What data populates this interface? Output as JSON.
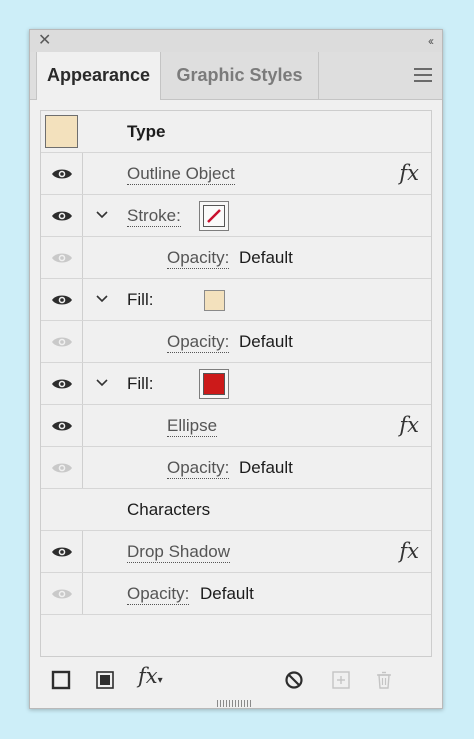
{
  "window": {
    "close_glyph": "✕",
    "collapse_glyph": "‹‹"
  },
  "tabs": [
    {
      "label": "Appearance",
      "active": true
    },
    {
      "label": "Graphic Styles",
      "active": false
    }
  ],
  "header": {
    "title": "Type",
    "swatch_color": "#f3e1bd"
  },
  "rows": [
    {
      "label": "Outline Object",
      "fx": "fx"
    },
    {
      "label": "Stroke:",
      "stroke_color": "#c8102e"
    },
    {
      "label": "Opacity:",
      "value": "Default"
    },
    {
      "label": "Fill:",
      "fill_color": "#f3e1bd"
    },
    {
      "label": "Opacity:",
      "value": "Default"
    },
    {
      "label": "Fill:",
      "fill_color": "#cc1a1a"
    },
    {
      "label": "Ellipse",
      "fx": "fx"
    },
    {
      "label": "Opacity:",
      "value": "Default"
    },
    {
      "label": "Characters"
    },
    {
      "label": "Drop Shadow",
      "fx": "fx"
    },
    {
      "label": "Opacity:",
      "value": "Default"
    }
  ],
  "footer": {
    "icons": [
      "add-new-stroke-icon",
      "add-new-fill-icon",
      "add-effect-icon",
      "clear-appearance-icon",
      "duplicate-item-icon",
      "delete-item-icon"
    ],
    "fx_label": "fx"
  },
  "colors": {
    "background": "#cdeef8",
    "panel": "#f0f0f0",
    "stroke": "#c8102e",
    "fill_red": "#cc1a1a",
    "fill_cream": "#f3e1bd"
  }
}
